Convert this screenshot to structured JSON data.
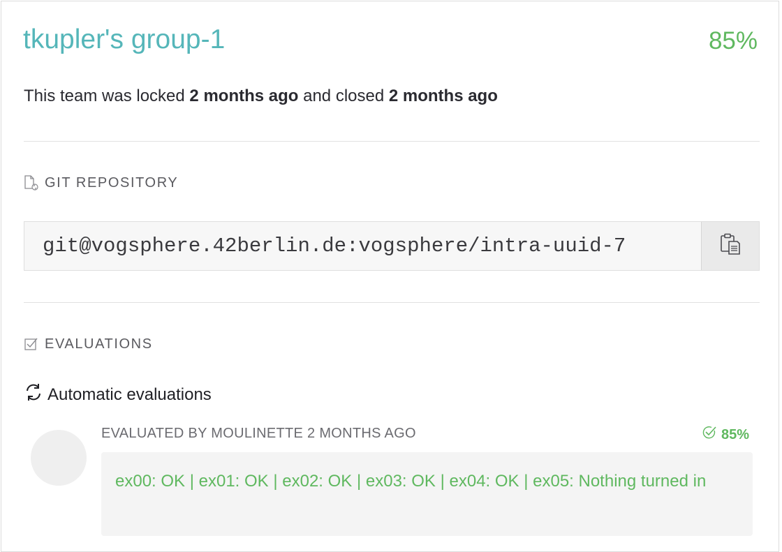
{
  "team": {
    "name": "tkupler's group-1",
    "score": "85%"
  },
  "status": {
    "prefix": "This team was locked ",
    "locked_ago": "2 months ago",
    "middle": " and closed ",
    "closed_ago": "2 months ago"
  },
  "git": {
    "section_title": "GIT REPOSITORY",
    "section_icon": "file-sync-icon",
    "repo_url": "git@vogsphere.42berlin.de:vogsphere/intra-uuid-7",
    "copy_icon": "clipboard-icon"
  },
  "evaluations": {
    "section_title": "EVALUATIONS",
    "section_icon": "checkbox-icon",
    "automatic_title": "Automatic evaluations",
    "automatic_icon": "refresh-icon",
    "items": [
      {
        "evaluator_line": "EVALUATED BY MOULINETTE 2 MONTHS AGO",
        "score": "85%",
        "score_icon": "check-circle-icon",
        "result": "ex00: OK | ex01: OK | ex02: OK | ex03: OK | ex04: OK | ex05: Nothing turned in"
      }
    ]
  },
  "colors": {
    "accent_teal": "#55b6b9",
    "success_green": "#5fb85f"
  }
}
